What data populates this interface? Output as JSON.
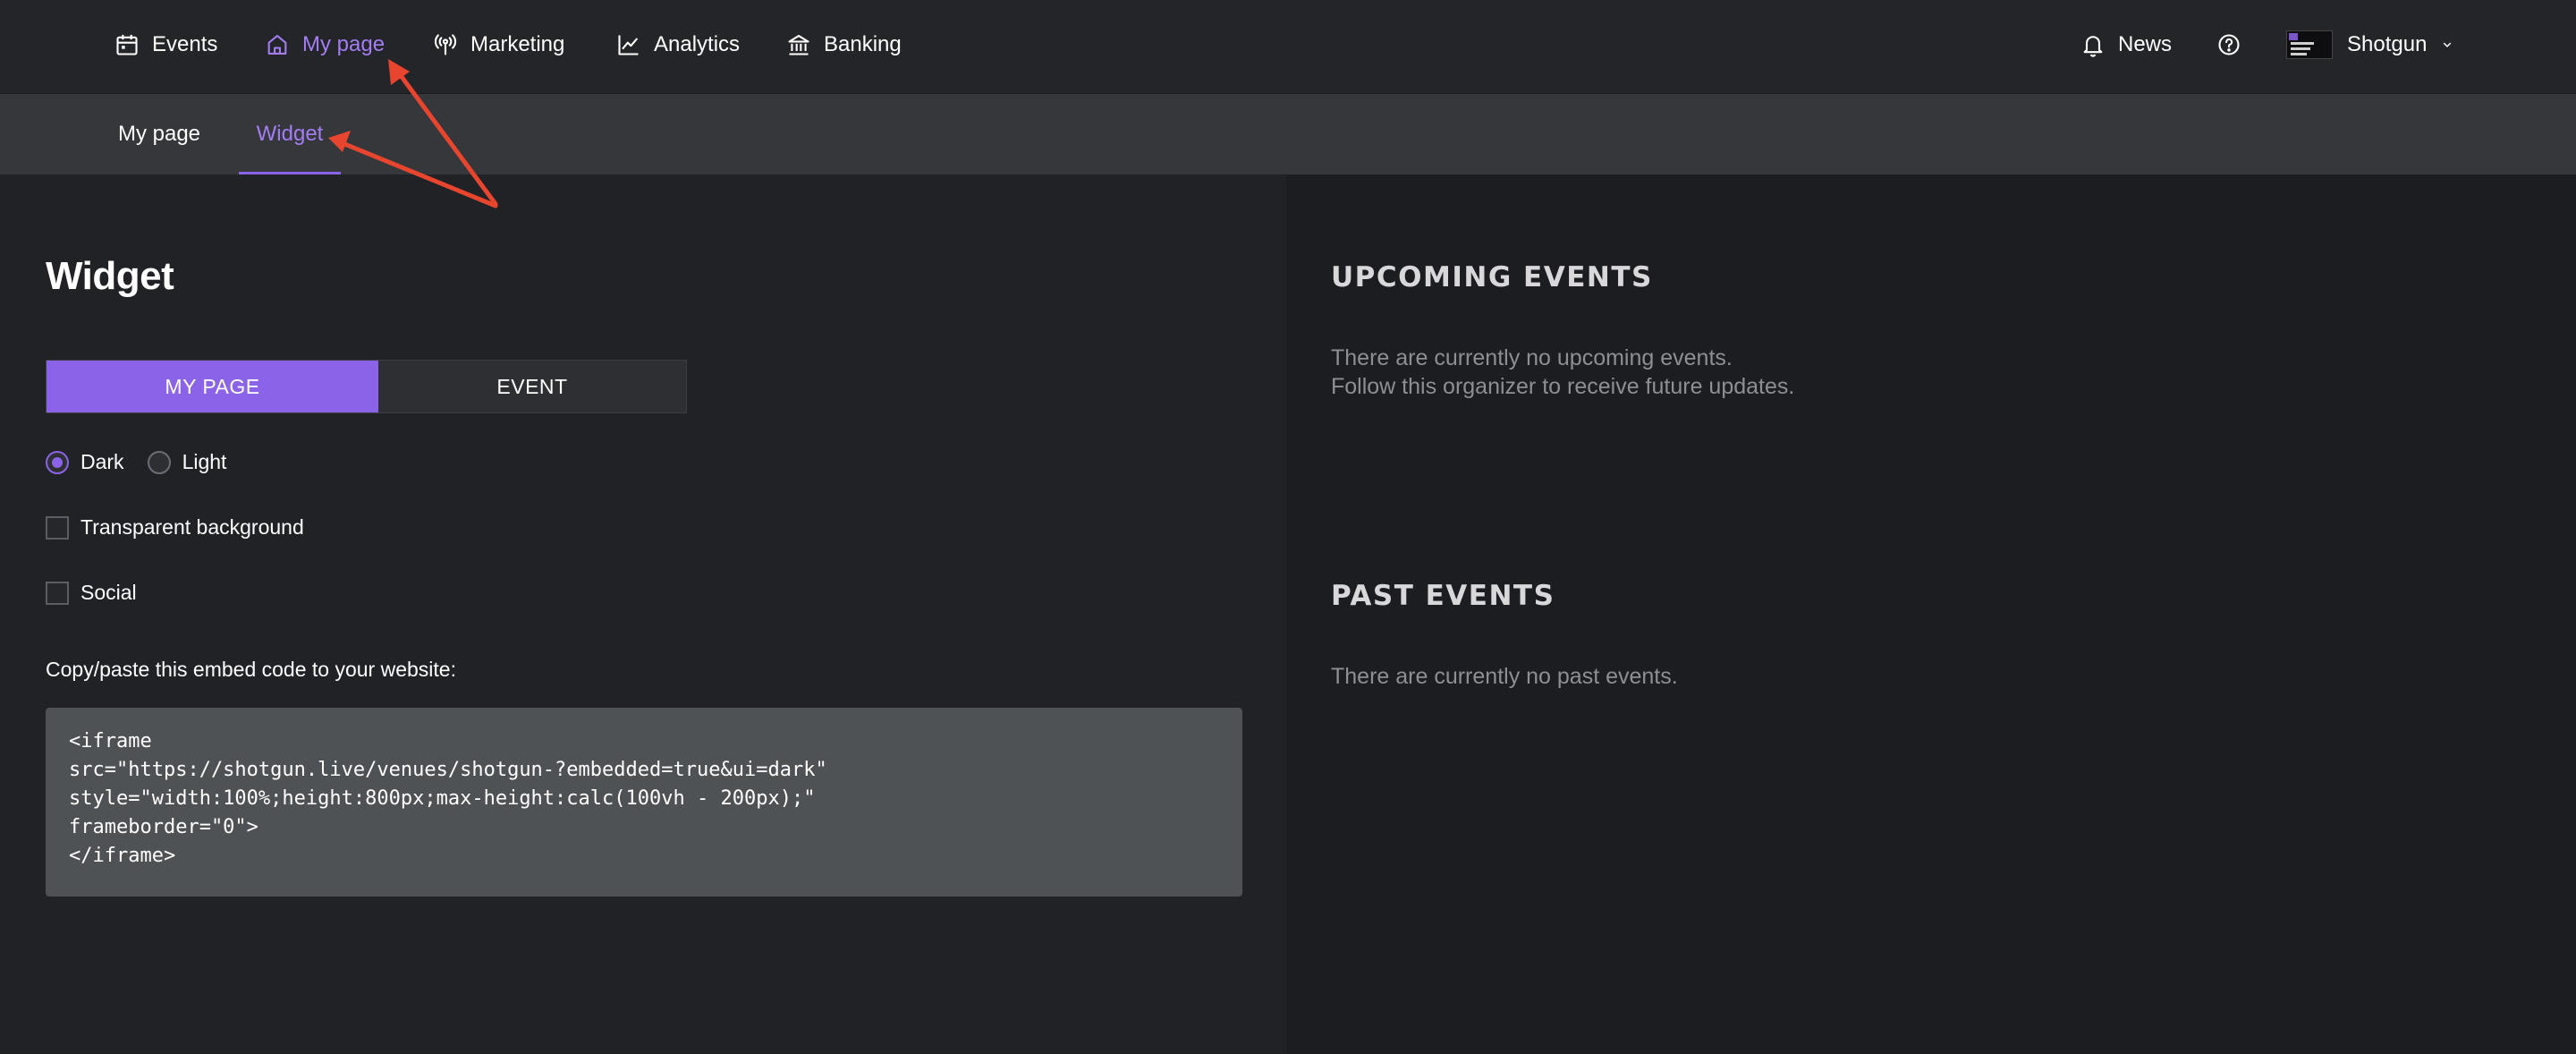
{
  "topnav": {
    "items": [
      {
        "label": "Events",
        "icon": "calendar-icon",
        "active": false
      },
      {
        "label": "My page",
        "icon": "home-icon",
        "active": true
      },
      {
        "label": "Marketing",
        "icon": "broadcast-icon",
        "active": false
      },
      {
        "label": "Analytics",
        "icon": "chart-line-icon",
        "active": false
      },
      {
        "label": "Banking",
        "icon": "bank-icon",
        "active": false
      }
    ],
    "news_label": "News",
    "help_icon": "help-circle-icon",
    "account_name": "Shotgun",
    "account_chevron": "chevron-down-icon"
  },
  "subnav": {
    "tabs": [
      {
        "label": "My page",
        "active": false
      },
      {
        "label": "Widget",
        "active": true
      }
    ]
  },
  "widget": {
    "title": "Widget",
    "segments": {
      "my_page": "MY PAGE",
      "event": "EVENT",
      "selected": "MY PAGE"
    },
    "theme": {
      "dark": "Dark",
      "light": "Light",
      "selected": "Dark"
    },
    "transparent_background": {
      "label": "Transparent background",
      "checked": false
    },
    "social": {
      "label": "Social",
      "checked": false
    },
    "embed_label": "Copy/paste this embed code to your website:",
    "embed_code": "<iframe\nsrc=\"https://shotgun.live/venues/shotgun-?embedded=true&ui=dark\"\nstyle=\"width:100%;height:800px;max-height:calc(100vh - 200px);\"\nframeborder=\"0\">\n</iframe>"
  },
  "preview": {
    "upcoming_title": "UPCOMING EVENTS",
    "upcoming_line1": "There are currently no upcoming events.",
    "upcoming_line2": "Follow this organizer to receive future updates.",
    "past_title": "PAST EVENTS",
    "past_text": "There are currently no past events."
  },
  "colors": {
    "accent": "#8b63e8",
    "accent_text": "#a27df2",
    "annotation_arrow": "#e8452e"
  }
}
